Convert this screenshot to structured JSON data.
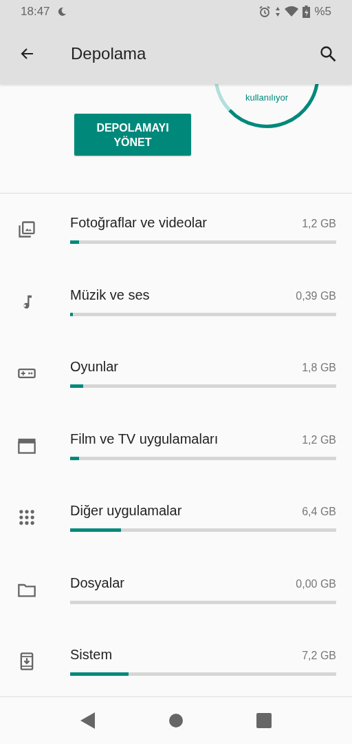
{
  "status_bar": {
    "time": "18:47",
    "battery": "%5"
  },
  "toolbar": {
    "title": "Depolama"
  },
  "summary": {
    "ring_label": "kullanılıyor",
    "button": "DEPOLAMAYI YÖNET"
  },
  "categories": [
    {
      "kind": "photos",
      "name": "Fotoğraflar ve videolar",
      "size": "1,2 GB",
      "level": 0.034
    },
    {
      "kind": "music",
      "name": "Müzik ve ses",
      "size": "0,39 GB",
      "level": 0.01
    },
    {
      "kind": "games",
      "name": "Oyunlar",
      "size": "1,8 GB",
      "level": 0.05
    },
    {
      "kind": "movies",
      "name": "Film ve TV uygulamaları",
      "size": "1,2 GB",
      "level": 0.034
    },
    {
      "kind": "apps",
      "name": "Diğer uygulamalar",
      "size": "6,4 GB",
      "level": 0.19
    },
    {
      "kind": "files",
      "name": "Dosyalar",
      "size": "0,00 GB",
      "level": 0
    },
    {
      "kind": "system",
      "name": "Sistem",
      "size": "7,2 GB",
      "level": 0.22
    }
  ]
}
